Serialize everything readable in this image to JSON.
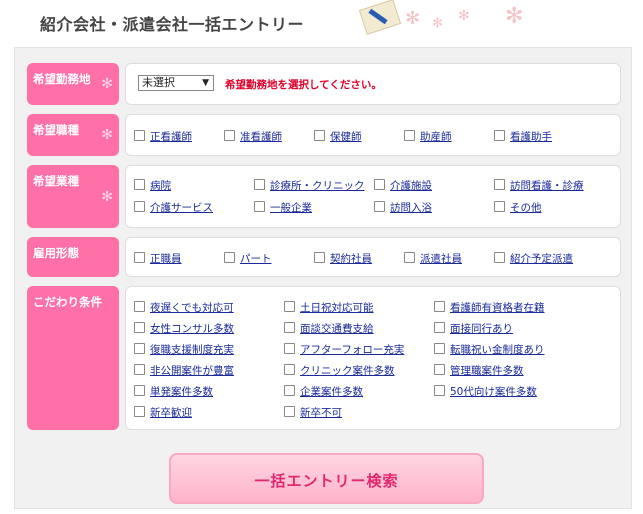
{
  "header": {
    "title": "紹介会社・派遣会社一括エントリー"
  },
  "location": {
    "label": "希望勤務地",
    "select_value": "未選択",
    "error": "希望勤務地を選択してください。"
  },
  "job": {
    "label": "希望職種",
    "options": [
      "正看護師",
      "准看護師",
      "保健師",
      "助産師",
      "看護助手"
    ]
  },
  "industry": {
    "label": "希望業種",
    "options": [
      "病院",
      "診療所・クリニック",
      "介護施設",
      "訪問看護・診療",
      "介護サービス",
      "一般企業",
      "訪問入浴",
      "その他"
    ]
  },
  "employment": {
    "label": "雇用形態",
    "options": [
      "正職員",
      "パート",
      "契約社員",
      "派遣社員",
      "紹介予定派遣"
    ]
  },
  "conditions": {
    "label": "こだわり条件",
    "options": [
      "夜遅くでも対応可",
      "土日祝対応可能",
      "看護師有資格者在籍",
      "女性コンサル多数",
      "面談交通費支給",
      "面接同行あり",
      "復職支援制度充実",
      "アフターフォロー充実",
      "転職祝い金制度あり",
      "非公開案件が豊富",
      "クリニック案件多数",
      "管理職案件多数",
      "単発案件多数",
      "企業案件多数",
      "50代向け案件多数",
      "新卒歓迎",
      "新卒不可"
    ]
  },
  "submit": {
    "label": "一括エントリー検索"
  },
  "colors": {
    "accent": "#ff6fa8",
    "link": "#1a2a9a",
    "error": "#e0002a"
  }
}
